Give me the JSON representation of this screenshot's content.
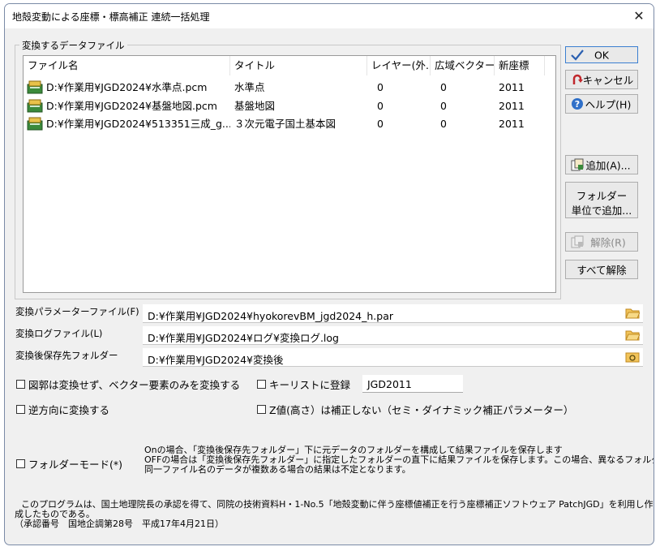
{
  "window": {
    "title": "地殻変動による座標・標高補正 連続一括処理",
    "close_glyph": "✕"
  },
  "files_group": {
    "label": "変換するデータファイル",
    "columns": [
      "ファイル名",
      "タイトル",
      "レイヤー(外...",
      "広域ベクター",
      "新座標"
    ],
    "rows": [
      {
        "file": "D:¥作業用¥JGD2024¥水準点.pcm",
        "title": "水準点",
        "layer": "0",
        "vector": "0",
        "new_coord": "2011"
      },
      {
        "file": "D:¥作業用¥JGD2024¥基盤地図.pcm",
        "title": "基盤地図",
        "layer": "0",
        "vector": "0",
        "new_coord": "2011"
      },
      {
        "file": "D:¥作業用¥JGD2024¥513351三成_g...",
        "title": "３次元電子国土基本図",
        "layer": "0",
        "vector": "0",
        "new_coord": "2011"
      }
    ]
  },
  "buttons": {
    "ok": "OK",
    "cancel": "キャンセル",
    "help": "ヘルプ(H)",
    "add": "追加(A)...",
    "add_folder_line1": "フォルダー",
    "add_folder_line2": "単位で追加...",
    "remove": "解除(R)",
    "remove_all": "すべて解除"
  },
  "fields": {
    "param_label": "変換パラメーターファイル(F)",
    "param_value": "D:¥作業用¥JGD2024¥hyokorevBM_jgd2024_h.par",
    "log_label": "変換ログファイル(L)",
    "log_value": "D:¥作業用¥JGD2024¥ログ¥変換ログ.log",
    "dest_label": "変換後保存先フォルダー",
    "dest_value": "D:¥作業用¥JGD2024¥変換後"
  },
  "options": {
    "vector_only": "図郭は変換せず、ベクター要素のみを変換する",
    "key_list": "キーリストに登録",
    "key_list_value": "JGD2011",
    "reverse": "逆方向に変換する",
    "no_z": "Z値(高さ）は補正しない（セミ・ダイナミック補正パラメーター）",
    "folder_mode": "フォルダーモード(*)",
    "folder_mode_desc1": "Onの場合、「変換後保存先フォルダー」下に元データのフォルダーを構成して結果ファイルを保存します",
    "folder_mode_desc2": "OFFの場合は「変換後保存先フォルダー」に指定したフォルダーの直下に結果ファイルを保存します。この場合、異なるフォルダーで",
    "folder_mode_desc3": "同一ファイル名のデータが複数ある場合の結果は不定となります。"
  },
  "notice": {
    "line1": "このプログラムは、国土地理院長の承認を得て、同院の技術資料H・1-No.5「地殻変動に伴う座標値補正を行う座標補正ソフトウェア PatchJGD」を利用し作",
    "line2": "成したものである。",
    "line3": "（承認番号　国地企調第28号　平成17年4月21日）"
  }
}
